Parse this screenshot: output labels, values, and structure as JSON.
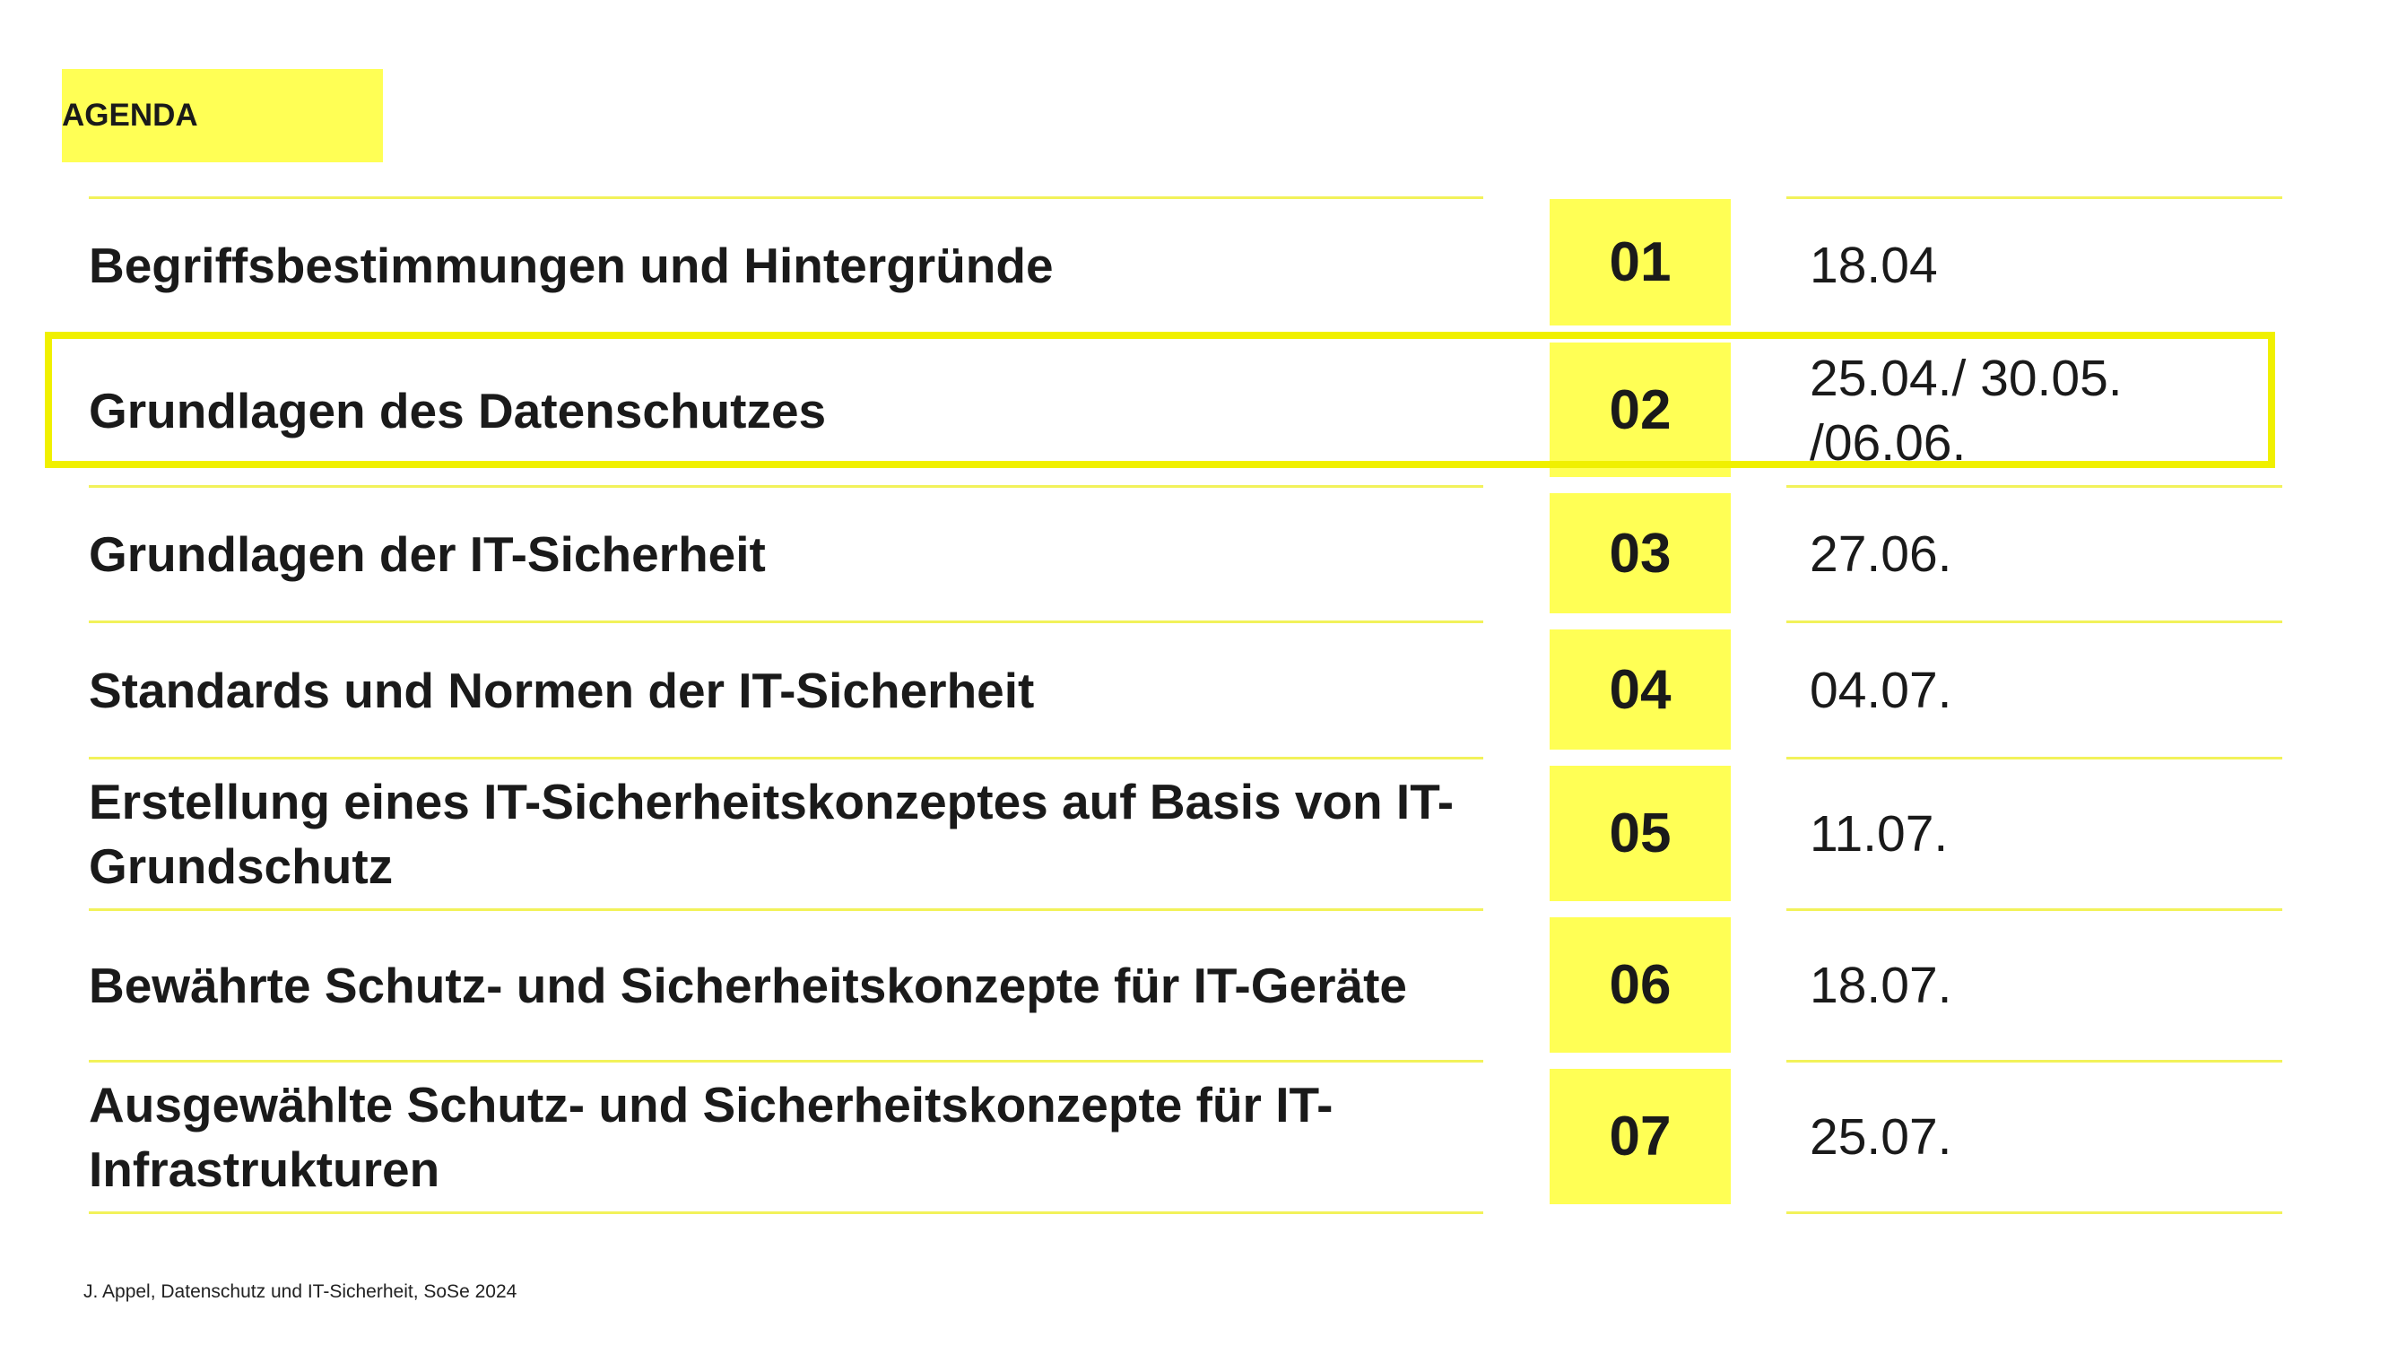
{
  "header": {
    "label": "AGENDA"
  },
  "items": [
    {
      "title": "Begriffsbestimmungen und Hintergründe",
      "number": "01",
      "date": "18.04"
    },
    {
      "title": "Grundlagen des Datenschutzes",
      "number": "02",
      "date": "25.04./ 30.05. /06.06."
    },
    {
      "title": "Grundlagen der IT-Sicherheit",
      "number": "03",
      "date": "27.06."
    },
    {
      "title": "Standards und Normen der IT-Sicherheit",
      "number": "04",
      "date": "04.07."
    },
    {
      "title": "Erstellung eines IT-Sicherheitskonzeptes auf Basis von IT-Grundschutz",
      "number": "05",
      "date": "11.07."
    },
    {
      "title": "Bewährte Schutz- und Sicherheitskonzepte für IT-Geräte",
      "number": "06",
      "date": "18.07."
    },
    {
      "title": "Ausgewählte Schutz- und Sicherheitskonzepte für IT-Infrastrukturen",
      "number": "07",
      "date": "25.07."
    }
  ],
  "highlighted_item": "02",
  "footer": {
    "text": "J. Appel, Datenschutz und IT-Sicherheit, SoSe 2024"
  },
  "colors": {
    "accent": "#ffff55",
    "frame": "#f0f000",
    "rule": "#f2f25a"
  }
}
